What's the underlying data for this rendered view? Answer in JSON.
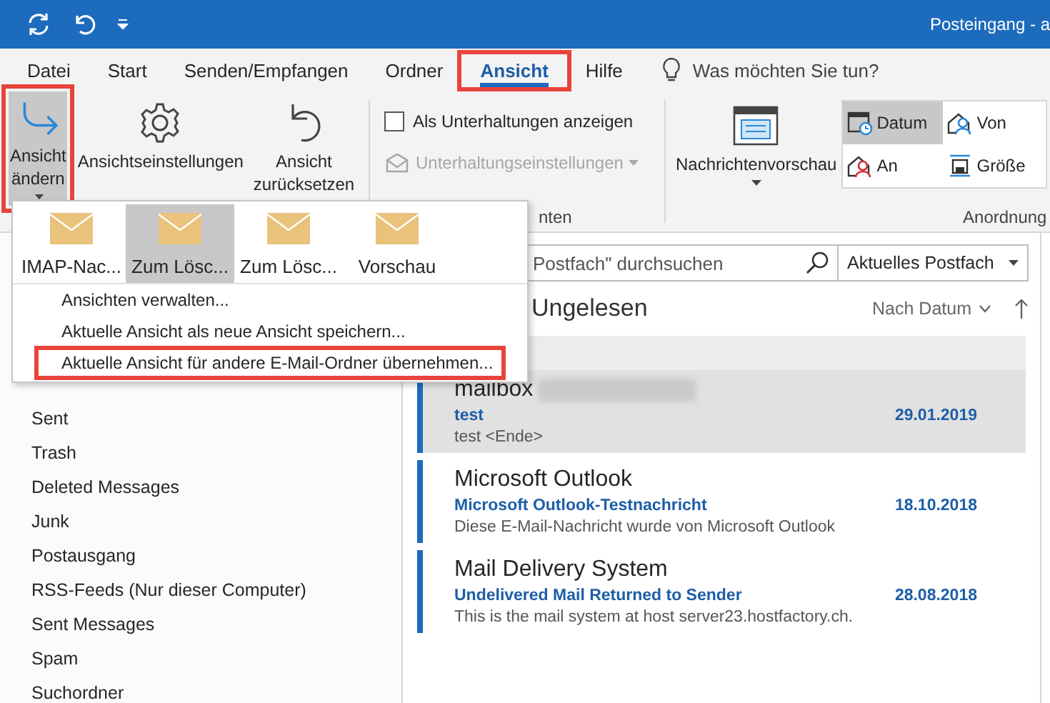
{
  "window": {
    "title": "Posteingang - a"
  },
  "menu_tabs": [
    {
      "label": "Datei",
      "selected": false,
      "highlighted": false
    },
    {
      "label": "Start",
      "selected": false,
      "highlighted": false
    },
    {
      "label": "Senden/Empfangen",
      "selected": false,
      "highlighted": false
    },
    {
      "label": "Ordner",
      "selected": false,
      "highlighted": false
    },
    {
      "label": "Ansicht",
      "selected": true,
      "highlighted": true
    },
    {
      "label": "Hilfe",
      "selected": false,
      "highlighted": false
    }
  ],
  "tell_me": {
    "placeholder": "Was möchten Sie tun?"
  },
  "ribbon": {
    "view_buttons": [
      {
        "label": "Ansicht ändern",
        "kind": "arrow",
        "selected": true,
        "highlighted": true,
        "dropdown": true
      },
      {
        "label": "Ansichtseinstellungen",
        "kind": "gear",
        "selected": false,
        "highlighted": false,
        "dropdown": false
      },
      {
        "label": "Ansicht zurücksetzen",
        "kind": "undo",
        "selected": false,
        "highlighted": false,
        "dropdown": false
      }
    ],
    "conversations": {
      "checkbox": {
        "label": "Als Unterhaltungen anzeigen",
        "checked": false
      },
      "settings": {
        "label": "Unterhaltungseinstellungen",
        "disabled": true
      },
      "group_label": "nten"
    },
    "arrangement": {
      "preview": {
        "label": "Nachrichtenvorschau"
      },
      "options": [
        {
          "label": "Datum",
          "kind": "calendar",
          "selected": true
        },
        {
          "label": "Von",
          "kind": "sender",
          "selected": false
        },
        {
          "label": "An",
          "kind": "recipient",
          "selected": false
        },
        {
          "label": "Größe",
          "kind": "size",
          "selected": false
        }
      ],
      "group_label": "Anordnung"
    }
  },
  "view_menu": {
    "gallery": [
      {
        "label": "IMAP-Nac...",
        "selected": false
      },
      {
        "label": "Zum Lösc...",
        "selected": true
      },
      {
        "label": "Zum Lösc...",
        "selected": false
      },
      {
        "label": "Vorschau",
        "selected": false
      }
    ],
    "items": [
      {
        "label": "Ansichten verwalten...",
        "highlighted": false
      },
      {
        "label": "Aktuelle Ansicht als neue Ansicht speichern...",
        "highlighted": false
      },
      {
        "label": "Aktuelle Ansicht für andere E-Mail-Ordner übernehmen...",
        "highlighted": true
      }
    ]
  },
  "folders": [
    "Sent",
    "Trash",
    "Deleted Messages",
    "Junk",
    "Postausgang",
    "RSS-Feeds (Nur dieser Computer)",
    "Sent Messages",
    "Spam",
    "Suchordner"
  ],
  "search": {
    "placeholder": "Postfach\" durchsuchen",
    "scope": "Aktuelles Postfach"
  },
  "list_header": {
    "filter": "Ungelesen",
    "sort": "Nach Datum"
  },
  "messages": [
    {
      "sender": "mailbox",
      "subject": "test",
      "date": "29.01.2019",
      "preview": "test <Ende>",
      "selected": true,
      "unread": true
    },
    {
      "sender": "Microsoft Outlook",
      "subject": "Microsoft Outlook-Testnachricht",
      "date": "18.10.2018",
      "preview": "Diese E-Mail-Nachricht wurde von Microsoft Outlook",
      "selected": false,
      "unread": true
    },
    {
      "sender": "Mail Delivery System",
      "subject": "Undelivered Mail Returned to Sender",
      "date": "28.08.2018",
      "preview": "This is the mail system at host server23.hostfactory.ch.",
      "selected": false,
      "unread": true
    }
  ]
}
